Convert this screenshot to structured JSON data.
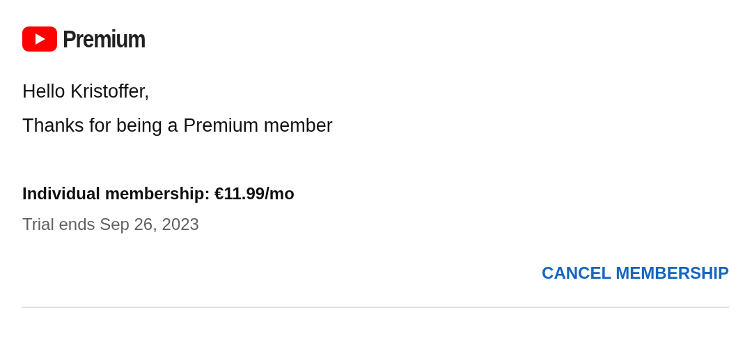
{
  "logo": {
    "text": "Premium"
  },
  "greeting": "Hello Kristoffer,",
  "message": "Thanks for being a Premium member",
  "membership": {
    "plan": "Individual membership: €11.99/mo",
    "status": "Trial ends Sep 26, 2023"
  },
  "action": {
    "label": "CANCEL MEMBERSHIP"
  }
}
